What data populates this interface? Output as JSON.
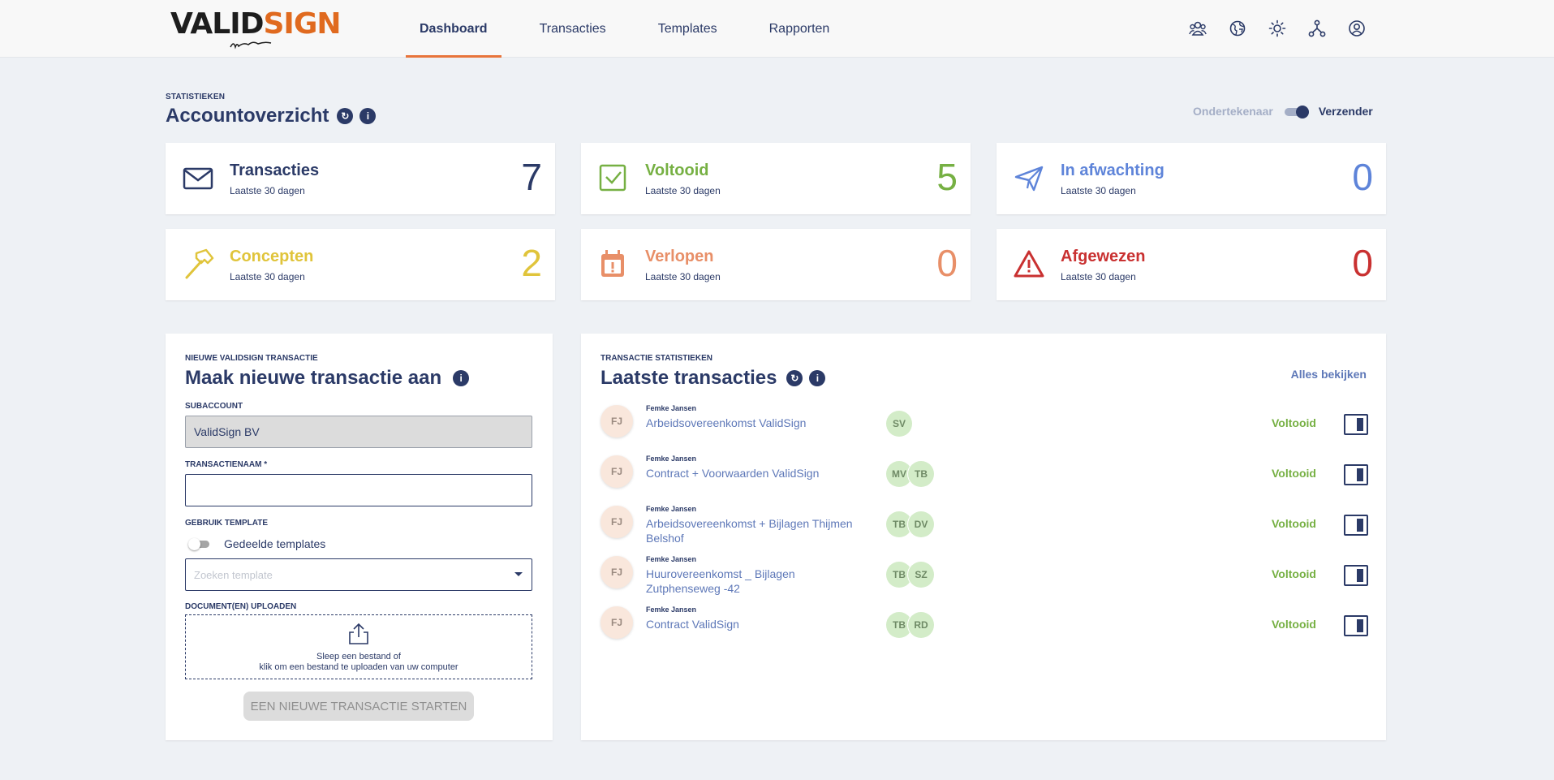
{
  "header": {
    "logo": {
      "part1": "VALID",
      "part2": "SIGN"
    },
    "nav": [
      "Dashboard",
      "Transacties",
      "Templates",
      "Rapporten"
    ],
    "icons": [
      "users-icon",
      "globe-icon",
      "sun-icon",
      "network-icon",
      "account-icon"
    ]
  },
  "stats": {
    "kicker": "STATISTIEKEN",
    "title": "Accountoverzicht",
    "toggle_off": "Ondertekenaar",
    "toggle_on": "Verzender",
    "cards": [
      {
        "title": "Transacties",
        "sub": "Laatste 30 dagen",
        "value": "7",
        "color": "#2b3a67",
        "icon": "envelope-icon"
      },
      {
        "title": "Voltooid",
        "sub": "Laatste 30 dagen",
        "value": "5",
        "color": "#76b043",
        "icon": "check-icon"
      },
      {
        "title": "In afwachting",
        "sub": "Laatste 30 dagen",
        "value": "0",
        "color": "#5e84d9",
        "icon": "paper-plane-icon"
      },
      {
        "title": "Concepten",
        "sub": "Laatste 30 dagen",
        "value": "2",
        "color": "#e0c43b",
        "icon": "hammer-icon"
      },
      {
        "title": "Verlopen",
        "sub": "Laatste 30 dagen",
        "value": "0",
        "color": "#e88f68",
        "icon": "calendar-alert-icon"
      },
      {
        "title": "Afgewezen",
        "sub": "Laatste 30 dagen",
        "value": "0",
        "color": "#c93131",
        "icon": "warning-icon"
      }
    ]
  },
  "new_tx": {
    "kicker": "NIEUWE VALIDSIGN TRANSACTIE",
    "title": "Maak nieuwe transactie aan",
    "subaccount_label": "SUBACCOUNT",
    "subaccount_value": "ValidSign BV",
    "name_label": "TRANSACTIENAAM *",
    "name_value": "",
    "template_label": "GEBRUIK TEMPLATE",
    "shared_templates": "Gedeelde templates",
    "template_placeholder": "Zoeken template",
    "upload_label": "DOCUMENT(EN) UPLOADEN",
    "upload_line1": "Sleep een bestand of",
    "upload_line2": "klik om een bestand te uploaden van uw computer",
    "start_button": "EEN NIEUWE TRANSACTIE STARTEN"
  },
  "latest": {
    "kicker": "TRANSACTIE STATISTIEKEN",
    "title": "Laatste transacties",
    "see_all": "Alles bekijken",
    "rows": [
      {
        "initials": "FJ",
        "owner": "Femke Jansen",
        "doc": "Arbeidsovereenkomst ValidSign",
        "signers": [
          "SV"
        ],
        "status": "Voltooid"
      },
      {
        "initials": "FJ",
        "owner": "Femke Jansen",
        "doc": "Contract + Voorwaarden ValidSign",
        "signers": [
          "MV",
          "TB"
        ],
        "status": "Voltooid"
      },
      {
        "initials": "FJ",
        "owner": "Femke Jansen",
        "doc": "Arbeidsovereenkomst + Bijlagen Thijmen Belshof",
        "signers": [
          "TB",
          "DV"
        ],
        "status": "Voltooid"
      },
      {
        "initials": "FJ",
        "owner": "Femke Jansen",
        "doc": "Huurovereenkomst _ Bijlagen Zutphenseweg -42",
        "signers": [
          "TB",
          "SZ"
        ],
        "status": "Voltooid"
      },
      {
        "initials": "FJ",
        "owner": "Femke Jansen",
        "doc": "Contract ValidSign",
        "signers": [
          "TB",
          "RD"
        ],
        "status": "Voltooid"
      }
    ]
  }
}
